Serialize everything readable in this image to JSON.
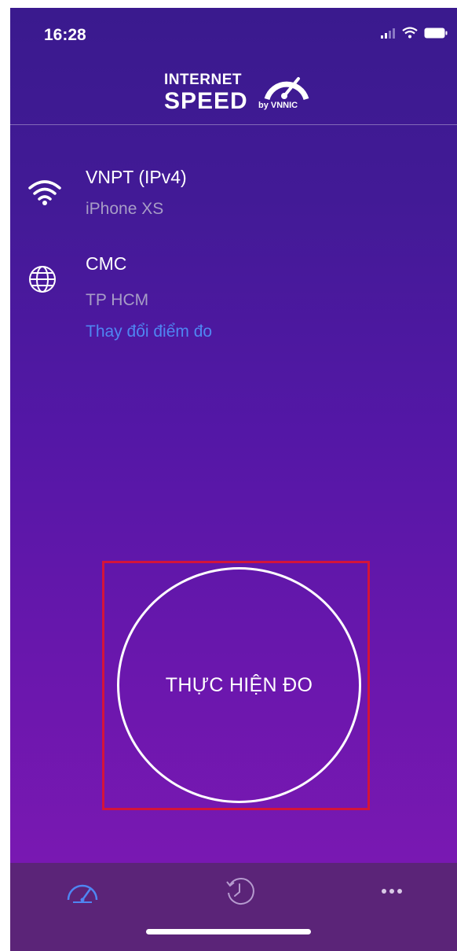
{
  "status_bar": {
    "time": "16:28"
  },
  "header": {
    "logo_line1": "INTERNET",
    "logo_line2": "SPEED",
    "logo_by": "by VNNIC"
  },
  "network": {
    "icon": "wifi-icon",
    "name": "VNPT (IPv4)",
    "device": "iPhone XS"
  },
  "server": {
    "icon": "globe-icon",
    "name": "CMC",
    "location": "TP HCM",
    "change_link": "Thay đổi điểm đo"
  },
  "measure_button": {
    "label": "THỰC HIỆN ĐO"
  },
  "tab_bar": {
    "tabs": [
      {
        "icon": "speedometer-icon",
        "active": true
      },
      {
        "icon": "history-icon",
        "active": false
      },
      {
        "icon": "more-icon",
        "active": false
      }
    ]
  },
  "colors": {
    "accent": "#4f86f2",
    "highlight": "#d4143a",
    "tab_bar": "#5b2478"
  }
}
